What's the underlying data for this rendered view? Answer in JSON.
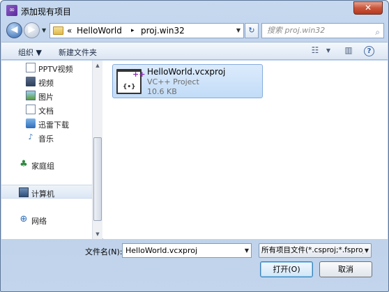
{
  "window": {
    "title": "添加现有项目",
    "close_glyph": "✕"
  },
  "navbar": {
    "back_glyph": "◀",
    "forward_glyph": "▶",
    "dropdown_glyph": "▼",
    "breadcrumb_overflow": "«",
    "breadcrumb": [
      "HelloWorld",
      "proj.win32"
    ],
    "breadcrumb_sep": "▸",
    "address_dropdown_glyph": "▼",
    "refresh_glyph": "↻",
    "search_placeholder": "搜索 proj.win32",
    "search_icon_glyph": "⌕"
  },
  "toolbar": {
    "organize_label": "组织 ▼",
    "new_folder_label": "新建文件夹",
    "view_glyph": "☷",
    "view_dropdown_glyph": "▼",
    "preview_glyph": "▥",
    "help_glyph": "?"
  },
  "nav_pane": {
    "items": [
      {
        "label": "PPTV视频",
        "icon": "pptv-video-icon"
      },
      {
        "label": "视频",
        "icon": "video-library-icon"
      },
      {
        "label": "图片",
        "icon": "picture-library-icon"
      },
      {
        "label": "文档",
        "icon": "document-library-icon"
      },
      {
        "label": "迅雷下载",
        "icon": "thunder-download-icon"
      },
      {
        "label": "音乐",
        "icon": "music-library-icon"
      },
      {
        "label": "家庭组",
        "icon": "homegroup-icon"
      },
      {
        "label": "计算机",
        "icon": "computer-icon",
        "selected": true
      },
      {
        "label": "网络",
        "icon": "network-icon"
      }
    ],
    "glyphs": {
      "music": "♪",
      "home": "♣",
      "net": "⊕"
    },
    "scroll_up": "▲",
    "scroll_down": "▼"
  },
  "files": [
    {
      "name": "HelloWorld.vcxproj",
      "type": "VC++ Project",
      "size": "10.6 KB",
      "icon": "vcxproj-file-icon"
    }
  ],
  "vcx_glyphs": {
    "plus": "++",
    "body": "{•}"
  },
  "footer": {
    "filename_label": "文件名(N):",
    "filename_value": "HelloWorld.vcxproj",
    "combo_glyph": "▼",
    "filter_value": "所有项目文件(*.csproj;*.fsproj",
    "open_label": "打开(O)",
    "cancel_label": "取消"
  }
}
